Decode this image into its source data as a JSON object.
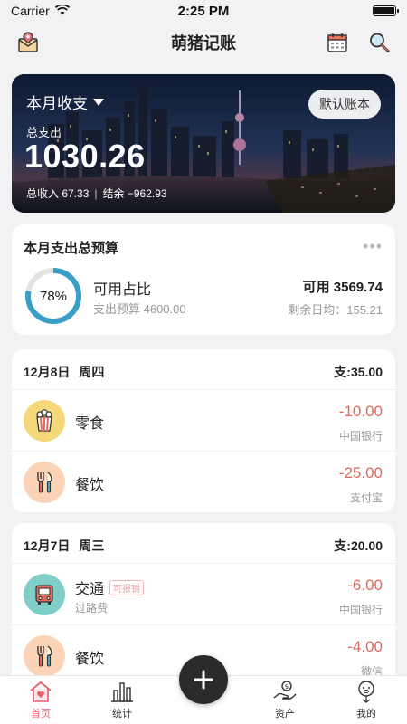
{
  "status_bar": {
    "carrier": "Carrier",
    "time": "2:25 PM"
  },
  "nav": {
    "title": "萌猪记账"
  },
  "hero": {
    "title": "本月收支",
    "account_button": "默认账本",
    "expense_label": "总支出",
    "expense_amount": "1030.26",
    "income_text": "总收入 67.33",
    "separator": "|",
    "balance_text": "结余 −962.93"
  },
  "budget": {
    "title": "本月支出总预算",
    "percent_text": "78%",
    "percent_value": 0.78,
    "available_label": "可用占比",
    "budget_text": "支出预算 4600.00",
    "available_amount": "可用  3569.74",
    "daily_text": "剩余日均：155.21"
  },
  "days": [
    {
      "date": "12月8日",
      "weekday": "周四",
      "total": "支:35.00",
      "entries": [
        {
          "icon": "popcorn-icon",
          "icon_bg": "#f5d87a",
          "name": "零食",
          "amount": "-10.00",
          "account": "中国银行"
        },
        {
          "icon": "utensils-icon",
          "icon_bg": "#fbd3b6",
          "name": "餐饮",
          "amount": "-25.00",
          "account": "支付宝"
        }
      ]
    },
    {
      "date": "12月7日",
      "weekday": "周三",
      "total": "支:20.00",
      "entries": [
        {
          "icon": "bus-icon",
          "icon_bg": "#7fcfc8",
          "name": "交通",
          "tag": "可报销",
          "note": "过路费",
          "amount": "-6.00",
          "account": "中国银行"
        },
        {
          "icon": "utensils-icon",
          "icon_bg": "#fbd3b6",
          "name": "餐饮",
          "amount": "-4.00",
          "account": "微信"
        }
      ]
    }
  ],
  "tabs": [
    {
      "label": "首页",
      "icon": "home-icon"
    },
    {
      "label": "统计",
      "icon": "chart-icon"
    },
    {
      "label": "资产",
      "icon": "wallet-icon"
    },
    {
      "label": "我的",
      "icon": "profile-icon"
    }
  ],
  "colors": {
    "accent": "#e95c6a",
    "ring": "#3a9fc7",
    "expense": "#e06a5a"
  }
}
